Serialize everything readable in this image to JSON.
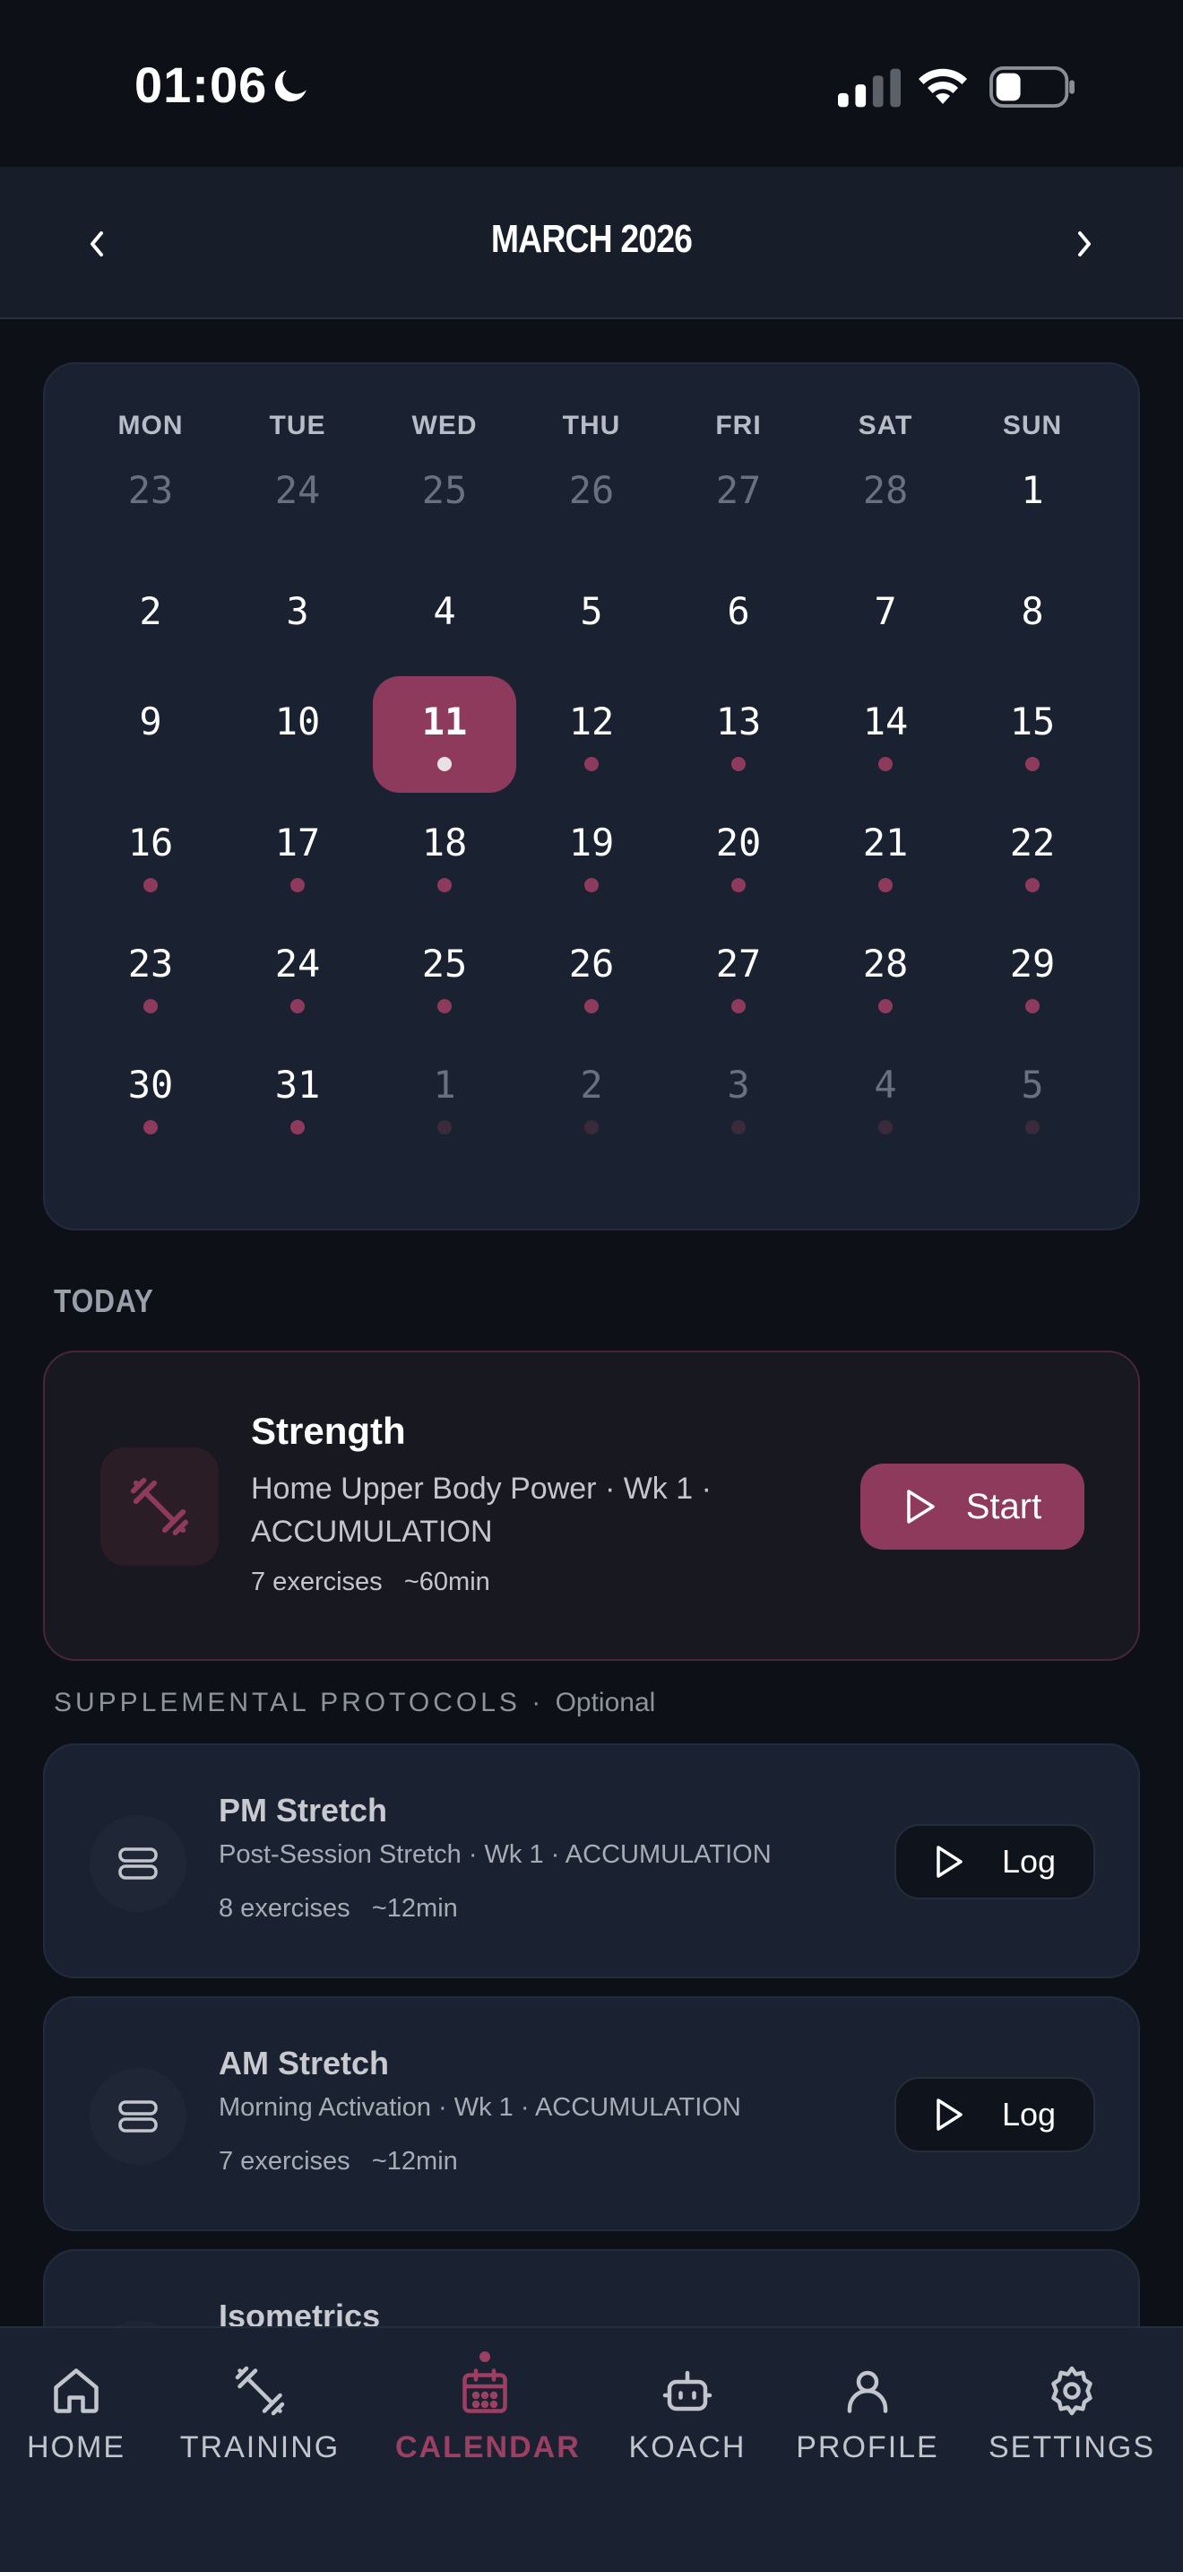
{
  "status_bar": {
    "time": "01:06",
    "moon_icon": "moon-icon",
    "signal_icon": "cellular-signal-icon",
    "wifi_icon": "wifi-icon",
    "battery_icon": "battery-icon"
  },
  "header": {
    "title": "MARCH 2026",
    "prev_icon": "chevron-left-icon",
    "next_icon": "chevron-right-icon"
  },
  "calendar": {
    "weekdays": [
      "MON",
      "TUE",
      "WED",
      "THU",
      "FRI",
      "SAT",
      "SUN"
    ],
    "weeks": [
      [
        "23",
        "24",
        "25",
        "26",
        "27",
        "28",
        "1"
      ],
      [
        "2",
        "3",
        "4",
        "5",
        "6",
        "7",
        "8"
      ],
      [
        "9",
        "10",
        "11",
        "12",
        "13",
        "14",
        "15"
      ],
      [
        "16",
        "17",
        "18",
        "19",
        "20",
        "21",
        "22"
      ],
      [
        "23",
        "24",
        "25",
        "26",
        "27",
        "28",
        "29"
      ],
      [
        "30",
        "31",
        "1",
        "2",
        "3",
        "4",
        "5"
      ]
    ],
    "selected_day": "11",
    "accent_color": "#8e3a5c"
  },
  "today": {
    "section_label": "TODAY",
    "title": "Strength",
    "subtitle": "Home Upper Body Power · Wk 1 · ACCUMULATION",
    "exercises": "7 exercises",
    "duration": "~60min",
    "icon": "dumbbell-icon",
    "start_label": "Start"
  },
  "supplemental": {
    "label": "SUPPLEMENTAL PROTOCOLS",
    "separator": " · ",
    "optional": "Optional",
    "protocols": [
      {
        "title": "PM Stretch",
        "subtitle": "Post-Session Stretch · Wk 1 · ACCUMULATION",
        "exercises": "8 exercises",
        "duration": "~12min",
        "log_label": "Log"
      },
      {
        "title": "AM Stretch",
        "subtitle": "Morning Activation · Wk 1 · ACCUMULATION",
        "exercises": "7 exercises",
        "duration": "~12min",
        "log_label": "Log"
      },
      {
        "title": "Isometrics"
      }
    ]
  },
  "bottom_nav": {
    "items": [
      {
        "label": "HOME",
        "icon": "home-icon"
      },
      {
        "label": "TRAINING",
        "icon": "dumbbell-icon"
      },
      {
        "label": "CALENDAR",
        "icon": "calendar-icon"
      },
      {
        "label": "KOACH",
        "icon": "robot-icon"
      },
      {
        "label": "PROFILE",
        "icon": "user-icon"
      },
      {
        "label": "SETTINGS",
        "icon": "gear-icon"
      }
    ],
    "active": "CALENDAR",
    "active_color": "#9c3f63"
  }
}
